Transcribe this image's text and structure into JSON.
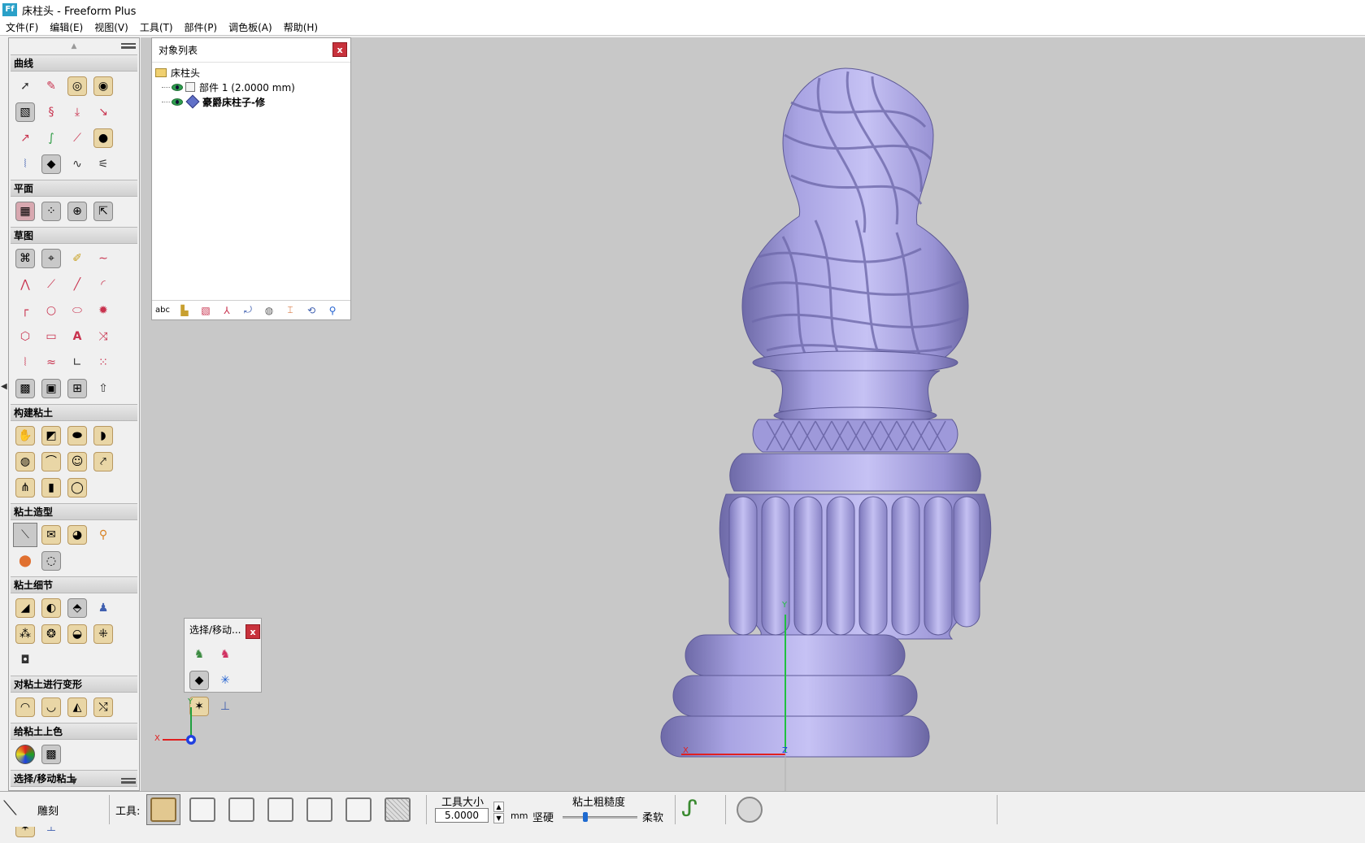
{
  "window": {
    "title": "床柱头 - Freeform Plus",
    "app_icon_label": "Ff"
  },
  "menu": [
    "文件(F)",
    "编辑(E)",
    "视图(V)",
    "工具(T)",
    "部件(P)",
    "调色板(A)",
    "帮助(H)"
  ],
  "toolbox": {
    "sections": [
      {
        "title": "曲线",
        "icons": [
          "select-arrow-icon",
          "curve-pen-icon",
          "spiral-curve-icon",
          "loop-curve-icon",
          "plane-curve-icon",
          "coil-icon",
          "drop-curve-icon",
          "bend-curve-icon",
          "offset-curve-icon",
          "green-curve-icon",
          "line-curve-icon",
          "sphere-point-icon",
          "mirror-curve-icon",
          "box-curve-icon",
          "wave-curve-icon",
          "wand-curve-icon"
        ]
      },
      {
        "title": "平面",
        "icons": [
          "plane-grid-icon",
          "plane-dots-icon",
          "plane-target-icon",
          "plane-move-icon"
        ]
      },
      {
        "title": "草图",
        "icons": [
          "sketch-lasso-icon",
          "sketch-trace-icon",
          "sketch-pen-icon",
          "sketch-curve-icon",
          "sketch-zigzag-icon",
          "sketch-polyline-icon",
          "sketch-line-icon",
          "sketch-arc-icon",
          "sketch-fillet-icon",
          "sketch-circle-icon",
          "sketch-ellipse-icon",
          "sketch-star-icon",
          "sketch-hexagon-icon",
          "sketch-rectangle-icon",
          "sketch-text-icon",
          "sketch-cross-icon",
          "sketch-mirror-icon",
          "sketch-wave-icon",
          "sketch-dimension-icon",
          "sketch-pattern-icon",
          "sketch-hatch-icon",
          "sketch-image-icon",
          "sketch-grid-icon",
          "sketch-extrude-icon"
        ]
      },
      {
        "title": "构建粘土",
        "icons": [
          "clay-hand-icon",
          "clay-wedge-icon",
          "clay-slab-icon",
          "clay-blob-icon",
          "clay-lump-icon",
          "clay-tube-icon",
          "clay-face-icon",
          "clay-path-icon",
          "clay-split-icon",
          "clay-block-icon",
          "clay-ring-icon"
        ]
      },
      {
        "title": "粘土造型",
        "icons": [
          "clay-carve-tool-icon",
          "clay-smudge-icon",
          "clay-smooth-icon",
          "clay-pin-icon",
          "clay-fill-icon",
          "clay-ring-tool-icon"
        ]
      },
      {
        "title": "粘土细节",
        "icons": [
          "detail-emboss-icon",
          "detail-wrap-icon",
          "detail-stamp-icon",
          "detail-figure-icon",
          "detail-texture-icon",
          "detail-pattern-icon",
          "detail-swirl-icon",
          "detail-grid-icon",
          "detail-decal-icon"
        ]
      },
      {
        "title": "对粘土进行变形",
        "icons": [
          "deform-bend-icon",
          "deform-twist-icon",
          "deform-taper-icon",
          "deform-warp-icon"
        ]
      },
      {
        "title": "给粘土上色",
        "icons": [
          "paint-color-icon",
          "paint-texture-icon"
        ]
      },
      {
        "title": "选择/移动粘土",
        "icons": [
          "select-piece-icon",
          "select-red-icon",
          "select-box-icon",
          "move-star-icon",
          "move-cube-icon",
          "move-axes-icon"
        ]
      }
    ]
  },
  "object_list": {
    "title": "对象列表",
    "close": "x",
    "root": "床柱头",
    "items": [
      {
        "label": "部件 1 (2.0000 mm)",
        "bold": false
      },
      {
        "label": "豪爵床柱子-修",
        "bold": true
      }
    ],
    "bottom_text": "abc",
    "bottom_icons": [
      "book-icon",
      "cube-red-icon",
      "axes-icon",
      "bend-icon",
      "sphere-icon",
      "pin-icon",
      "rotate-icon",
      "magnify-icon"
    ]
  },
  "select_move_palette": {
    "title": "选择/移动...",
    "close": "x",
    "icons": [
      "select-piece-icon",
      "select-red-icon",
      "select-box-icon",
      "move-star-icon",
      "move-cube-icon",
      "move-axes-icon"
    ]
  },
  "viewport": {
    "axis_labels": {
      "y": "Y",
      "x": "X",
      "z": "Z"
    },
    "model_color": "#a9a4e3"
  },
  "statusbar": {
    "tool_name": "雕刻",
    "tools_label": "工具:",
    "tool_size_label": "工具大小",
    "tool_size_value": "5.0000",
    "unit": "mm",
    "coarseness_label": "粘土粗糙度",
    "hard_label": "坚硬",
    "soft_label": "柔软",
    "coarseness_level": 0.3,
    "tools": [
      "carve-tool-icon",
      "smudge-tool-icon",
      "tug-tool-icon",
      "groove-tool-icon",
      "burnish-tool-icon",
      "smooth-tool-icon",
      "grid-tool-icon"
    ]
  }
}
